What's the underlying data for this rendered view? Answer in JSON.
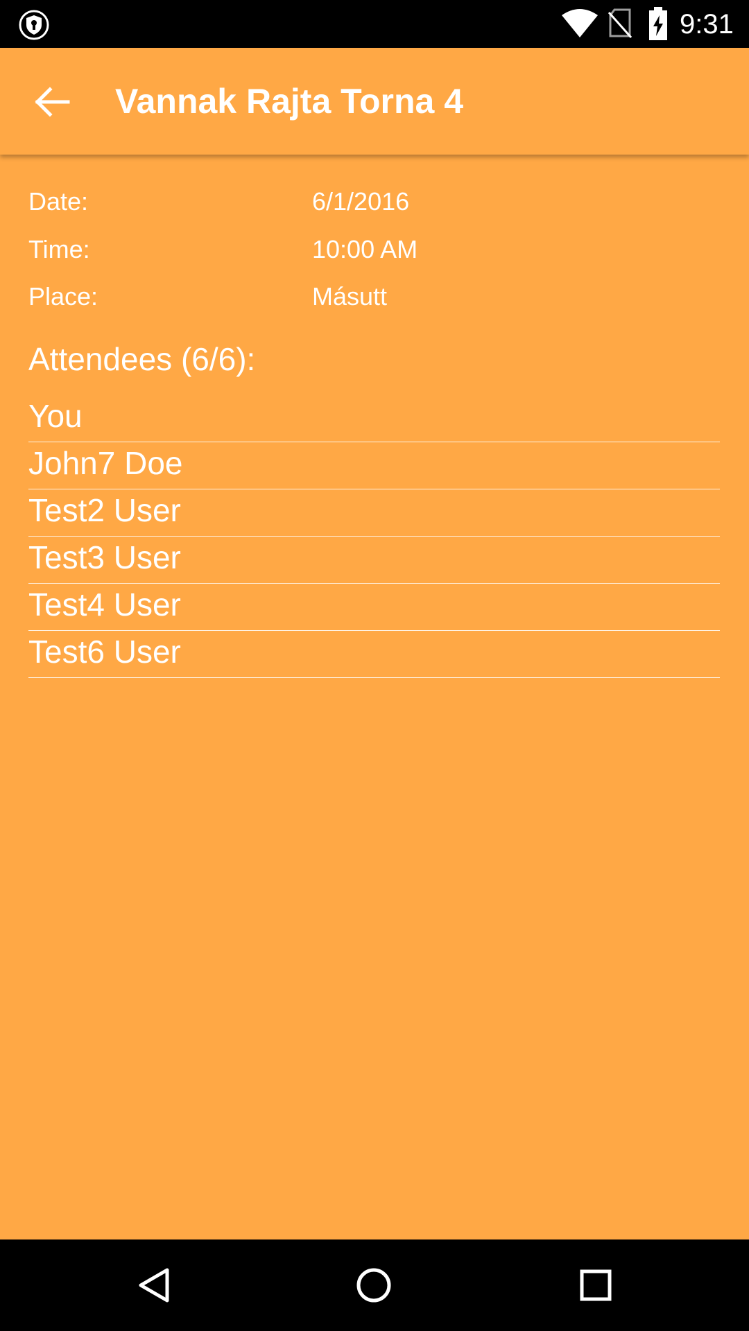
{
  "status_bar": {
    "time": "9:31",
    "icons": [
      "vpn-shield-icon",
      "wifi-icon",
      "no-sim-icon",
      "battery-charging-icon"
    ]
  },
  "toolbar": {
    "back_icon": "arrow-back-icon",
    "title": "Vannak Rajta Torna 4"
  },
  "event": {
    "date": {
      "label": "Date:",
      "value": "6/1/2016"
    },
    "time": {
      "label": "Time:",
      "value": "10:00 AM"
    },
    "place": {
      "label": "Place:",
      "value": "Másutt"
    }
  },
  "attendees": {
    "heading": "Attendees (6/6):",
    "items": [
      {
        "name": "You"
      },
      {
        "name": "John7 Doe"
      },
      {
        "name": "Test2 User"
      },
      {
        "name": "Test3 User"
      },
      {
        "name": "Test4 User"
      },
      {
        "name": "Test6 User"
      }
    ]
  },
  "nav_bar": {
    "icons": [
      "nav-back-icon",
      "nav-home-icon",
      "nav-recents-icon"
    ]
  },
  "colors": {
    "accent": "#FFA845",
    "text": "#FFFFFF",
    "system_bars": "#000000"
  }
}
